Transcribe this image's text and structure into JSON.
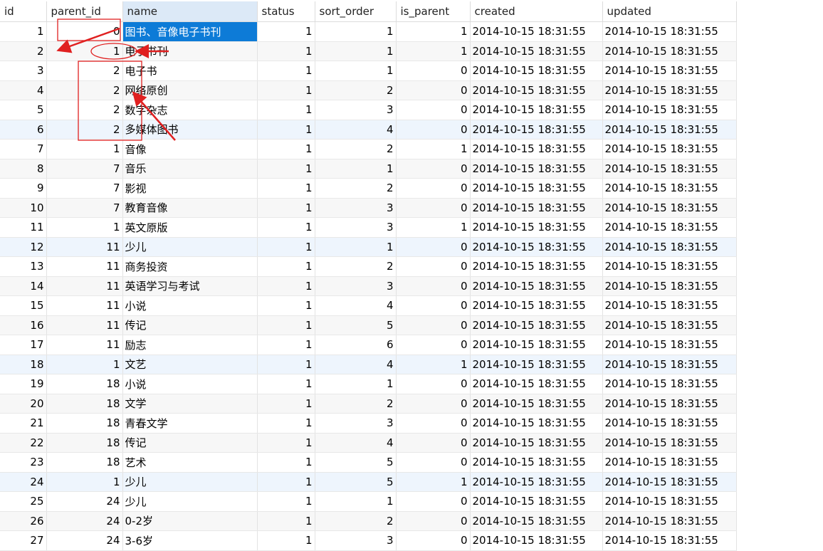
{
  "columns": [
    "id",
    "parent_id",
    "name",
    "status",
    "sort_order",
    "is_parent",
    "created",
    "updated"
  ],
  "rows": [
    [
      "1",
      "0",
      "图书、音像电子书刊",
      "1",
      "1",
      "1",
      "2014-10-15 18:31:55",
      "2014-10-15 18:31:55"
    ],
    [
      "2",
      "1",
      "电子书刊",
      "1",
      "1",
      "1",
      "2014-10-15 18:31:55",
      "2014-10-15 18:31:55"
    ],
    [
      "3",
      "2",
      "电子书",
      "1",
      "1",
      "0",
      "2014-10-15 18:31:55",
      "2014-10-15 18:31:55"
    ],
    [
      "4",
      "2",
      "网络原创",
      "1",
      "2",
      "0",
      "2014-10-15 18:31:55",
      "2014-10-15 18:31:55"
    ],
    [
      "5",
      "2",
      "数字杂志",
      "1",
      "3",
      "0",
      "2014-10-15 18:31:55",
      "2014-10-15 18:31:55"
    ],
    [
      "6",
      "2",
      "多媒体图书",
      "1",
      "4",
      "0",
      "2014-10-15 18:31:55",
      "2014-10-15 18:31:55"
    ],
    [
      "7",
      "1",
      "音像",
      "1",
      "2",
      "1",
      "2014-10-15 18:31:55",
      "2014-10-15 18:31:55"
    ],
    [
      "8",
      "7",
      "音乐",
      "1",
      "1",
      "0",
      "2014-10-15 18:31:55",
      "2014-10-15 18:31:55"
    ],
    [
      "9",
      "7",
      "影视",
      "1",
      "2",
      "0",
      "2014-10-15 18:31:55",
      "2014-10-15 18:31:55"
    ],
    [
      "10",
      "7",
      "教育音像",
      "1",
      "3",
      "0",
      "2014-10-15 18:31:55",
      "2014-10-15 18:31:55"
    ],
    [
      "11",
      "1",
      "英文原版",
      "1",
      "3",
      "1",
      "2014-10-15 18:31:55",
      "2014-10-15 18:31:55"
    ],
    [
      "12",
      "11",
      "少儿",
      "1",
      "1",
      "0",
      "2014-10-15 18:31:55",
      "2014-10-15 18:31:55"
    ],
    [
      "13",
      "11",
      "商务投资",
      "1",
      "2",
      "0",
      "2014-10-15 18:31:55",
      "2014-10-15 18:31:55"
    ],
    [
      "14",
      "11",
      "英语学习与考试",
      "1",
      "3",
      "0",
      "2014-10-15 18:31:55",
      "2014-10-15 18:31:55"
    ],
    [
      "15",
      "11",
      "小说",
      "1",
      "4",
      "0",
      "2014-10-15 18:31:55",
      "2014-10-15 18:31:55"
    ],
    [
      "16",
      "11",
      "传记",
      "1",
      "5",
      "0",
      "2014-10-15 18:31:55",
      "2014-10-15 18:31:55"
    ],
    [
      "17",
      "11",
      "励志",
      "1",
      "6",
      "0",
      "2014-10-15 18:31:55",
      "2014-10-15 18:31:55"
    ],
    [
      "18",
      "1",
      "文艺",
      "1",
      "4",
      "1",
      "2014-10-15 18:31:55",
      "2014-10-15 18:31:55"
    ],
    [
      "19",
      "18",
      "小说",
      "1",
      "1",
      "0",
      "2014-10-15 18:31:55",
      "2014-10-15 18:31:55"
    ],
    [
      "20",
      "18",
      "文学",
      "1",
      "2",
      "0",
      "2014-10-15 18:31:55",
      "2014-10-15 18:31:55"
    ],
    [
      "21",
      "18",
      "青春文学",
      "1",
      "3",
      "0",
      "2014-10-15 18:31:55",
      "2014-10-15 18:31:55"
    ],
    [
      "22",
      "18",
      "传记",
      "1",
      "4",
      "0",
      "2014-10-15 18:31:55",
      "2014-10-15 18:31:55"
    ],
    [
      "23",
      "18",
      "艺术",
      "1",
      "5",
      "0",
      "2014-10-15 18:31:55",
      "2014-10-15 18:31:55"
    ],
    [
      "24",
      "1",
      "少儿",
      "1",
      "5",
      "1",
      "2014-10-15 18:31:55",
      "2014-10-15 18:31:55"
    ],
    [
      "25",
      "24",
      "少儿",
      "1",
      "1",
      "0",
      "2014-10-15 18:31:55",
      "2014-10-15 18:31:55"
    ],
    [
      "26",
      "24",
      "0-2岁",
      "1",
      "2",
      "0",
      "2014-10-15 18:31:55",
      "2014-10-15 18:31:55"
    ],
    [
      "27",
      "24",
      "3-6岁",
      "1",
      "3",
      "0",
      "2014-10-15 18:31:55",
      "2014-10-15 18:31:55"
    ]
  ],
  "selected_cell": {
    "row": 1,
    "column": "name"
  },
  "selected_column": "name",
  "colors": {
    "selection": "#0d7bd7",
    "annotation": "#e02020",
    "column_header_selected": "#dce9f7"
  }
}
